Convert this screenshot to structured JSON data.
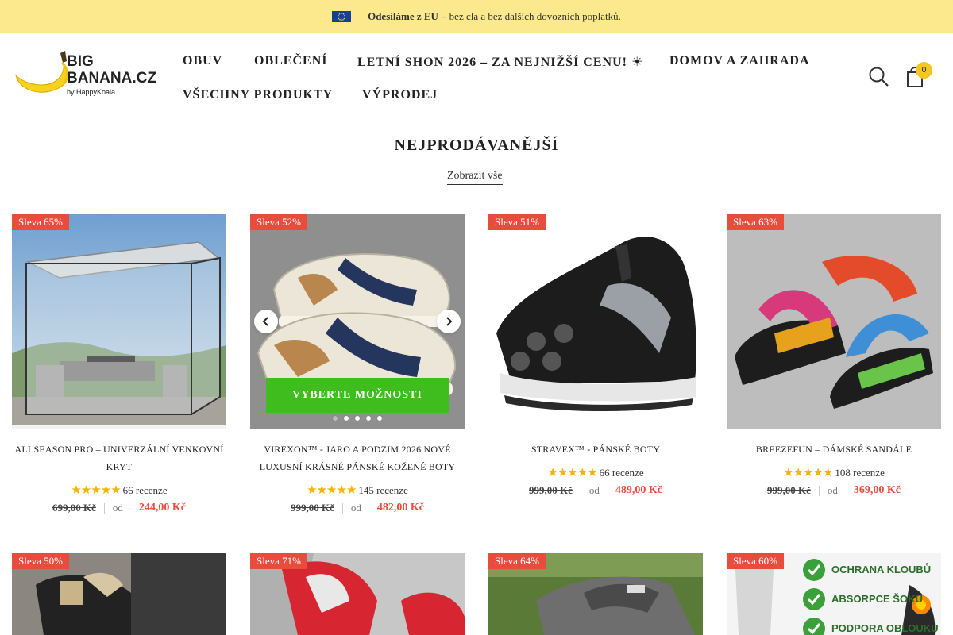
{
  "announcement": {
    "flag_icon": "eu-flag-icon",
    "bold": "Odesíláme z EU",
    "text": "– bez cla a bez dalších dovozních poplatků.",
    "bg_color": "#fce98e"
  },
  "header": {
    "logo": {
      "line1": "BIG",
      "line2": "BANANA.CZ",
      "tagline": "by HappyKoala"
    },
    "nav": [
      "OBUV",
      "OBLEČENÍ",
      "LETNÍ SHON 2026 – ZA NEJNIŽŠÍ CENU! ☀",
      "DOMOV A ZAHRADA",
      "VŠECHNY PRODUKTY",
      "VÝPRODEJ"
    ],
    "search_icon": "search-icon",
    "cart_icon": "cart-icon",
    "cart_count": "0"
  },
  "section": {
    "title": "NEJPRODÁVANĚJŠÍ",
    "view_all": "Zobrazit vše"
  },
  "products": [
    {
      "badge": "Sleva 65%",
      "title": "ALLSEASON PRO – UNIVERZÁLNÍ VENKOVNÍ KRYT",
      "stars": "★★★★★",
      "reviews": "66 recenze",
      "old_price": "699,00 Kč",
      "from": "od",
      "price": "244,00 Kč"
    },
    {
      "badge": "Sleva 52%",
      "title": "VIREXON™ - JARO A PODZIM 2026 NOVÉ LUXUSNÍ KRÁSNÉ PÁNSKÉ KOŽENÉ BOTY",
      "stars": "★★★★★",
      "reviews": "145 recenze",
      "old_price": "999,00 Kč",
      "from": "od",
      "price": "482,00 Kč",
      "button": "VYBERTE MOŽNOSTI",
      "image_count": 5,
      "image_index": 1
    },
    {
      "badge": "Sleva 51%",
      "title": "STRAVEX™ - PÁNSKÉ BOTY",
      "stars": "★★★★★",
      "reviews": "66 recenze",
      "old_price": "999,00 Kč",
      "from": "od",
      "price": "489,00 Kč"
    },
    {
      "badge": "Sleva 63%",
      "title": "BREEZEFUN – DÁMSKÉ SANDÁLE",
      "stars": "★★★★★",
      "reviews": "108 recenze",
      "old_price": "999,00 Kč",
      "from": "od",
      "price": "369,00 Kč"
    },
    {
      "badge": "Sleva 50%"
    },
    {
      "badge": "Sleva 71%"
    },
    {
      "badge": "Sleva 64%"
    },
    {
      "badge": "Sleva 60%",
      "features": [
        "OCHRANA KLOUBŮ",
        "ABSORPCE ŠOKU",
        "PODPORA OBLOUKU"
      ]
    }
  ],
  "colors": {
    "discount_badge": "#e84c3d",
    "sale_price": "#e84c3d",
    "stars": "#f5b400",
    "cta_button": "#3fbd1e",
    "cart_badge": "#f3c623"
  }
}
